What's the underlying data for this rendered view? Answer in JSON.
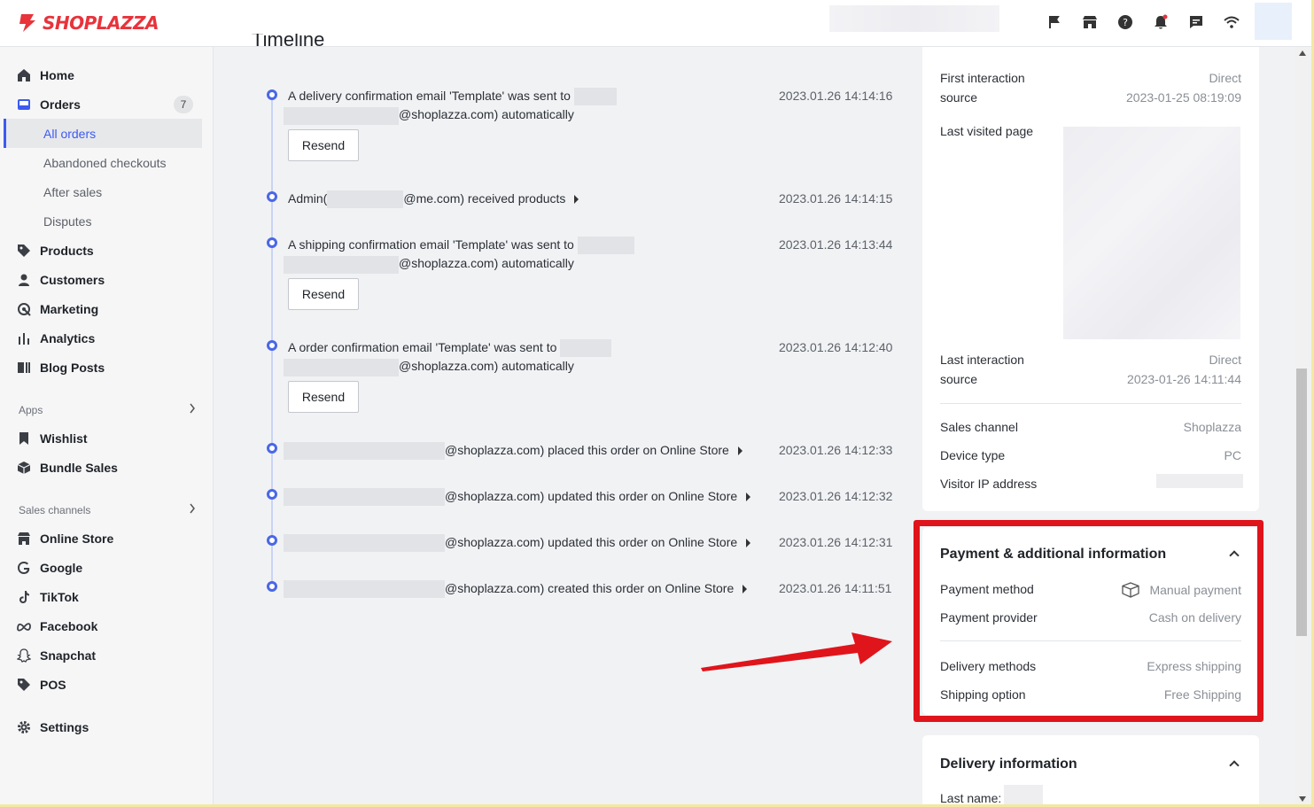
{
  "brand": {
    "name": "SHOPLAZZA",
    "color": "#e8333b"
  },
  "topbar": {
    "icons": [
      "flag-icon",
      "store-icon",
      "help-icon",
      "bell-icon",
      "chat-icon",
      "wifi-icon"
    ]
  },
  "sidebar": {
    "home": "Home",
    "orders": "Orders",
    "orders_badge": "7",
    "orders_sub": [
      "All orders",
      "Abandoned checkouts",
      "After sales",
      "Disputes"
    ],
    "products": "Products",
    "customers": "Customers",
    "marketing": "Marketing",
    "analytics": "Analytics",
    "blog_posts": "Blog Posts",
    "apps_label": "Apps",
    "wishlist": "Wishlist",
    "bundle_sales": "Bundle Sales",
    "sales_channels_label": "Sales channels",
    "online_store": "Online Store",
    "google": "Google",
    "tiktok": "TikTok",
    "facebook": "Facebook",
    "snapchat": "Snapchat",
    "pos": "POS",
    "settings": "Settings"
  },
  "timeline": {
    "title": "Timeline",
    "resend_label": "Resend",
    "events": [
      {
        "line1": "A delivery confirmation email 'Template' was sent to",
        "line2": "@shoplazza.com) automatically",
        "time": "2023.01.26 14:14:16"
      },
      {
        "line1": "Admin(",
        "line1b": "@me.com) received products",
        "time": "2023.01.26 14:14:15"
      },
      {
        "line1": "A shipping confirmation email 'Template' was sent to",
        "line2": "@shoplazza.com) automatically",
        "time": "2023.01.26 14:13:44"
      },
      {
        "line1": "A order confirmation email 'Template' was sent to",
        "line2": "@shoplazza.com) automatically",
        "time": "2023.01.26 14:12:40"
      },
      {
        "line1": "@shoplazza.com) placed this order on Online Store",
        "time": "2023.01.26 14:12:33"
      },
      {
        "line1": "@shoplazza.com) updated this order on Online Store",
        "time": "2023.01.26 14:12:32"
      },
      {
        "line1": "@shoplazza.com) updated this order on Online Store",
        "time": "2023.01.26 14:12:31"
      },
      {
        "line1": "@shoplazza.com) created this order on Online Store",
        "time": "2023.01.26 14:11:51"
      }
    ]
  },
  "session": {
    "first_interaction_label1": "First interaction",
    "first_interaction_label2": "source",
    "first_interaction_value": "Direct",
    "first_interaction_time": "2023-01-25 08:19:09",
    "last_visited_label": "Last visited page",
    "last_interaction_label1": "Last interaction",
    "last_interaction_label2": "source",
    "last_interaction_value": "Direct",
    "last_interaction_time": "2023-01-26 14:11:44",
    "sales_channel_label": "Sales channel",
    "sales_channel_value": "Shoplazza",
    "device_type_label": "Device type",
    "device_type_value": "PC",
    "visitor_ip_label": "Visitor IP address"
  },
  "payment": {
    "title": "Payment & additional information",
    "method_label": "Payment method",
    "method_value": "Manual payment",
    "provider_label": "Payment provider",
    "provider_value": "Cash on delivery",
    "delivery_methods_label": "Delivery methods",
    "delivery_methods_value": "Express shipping",
    "shipping_option_label": "Shipping option",
    "shipping_option_value": "Free Shipping"
  },
  "delivery": {
    "title": "Delivery information",
    "last_name_label": "Last name:"
  },
  "colors": {
    "accent": "#3d5af1",
    "highlight": "#e0141b"
  }
}
